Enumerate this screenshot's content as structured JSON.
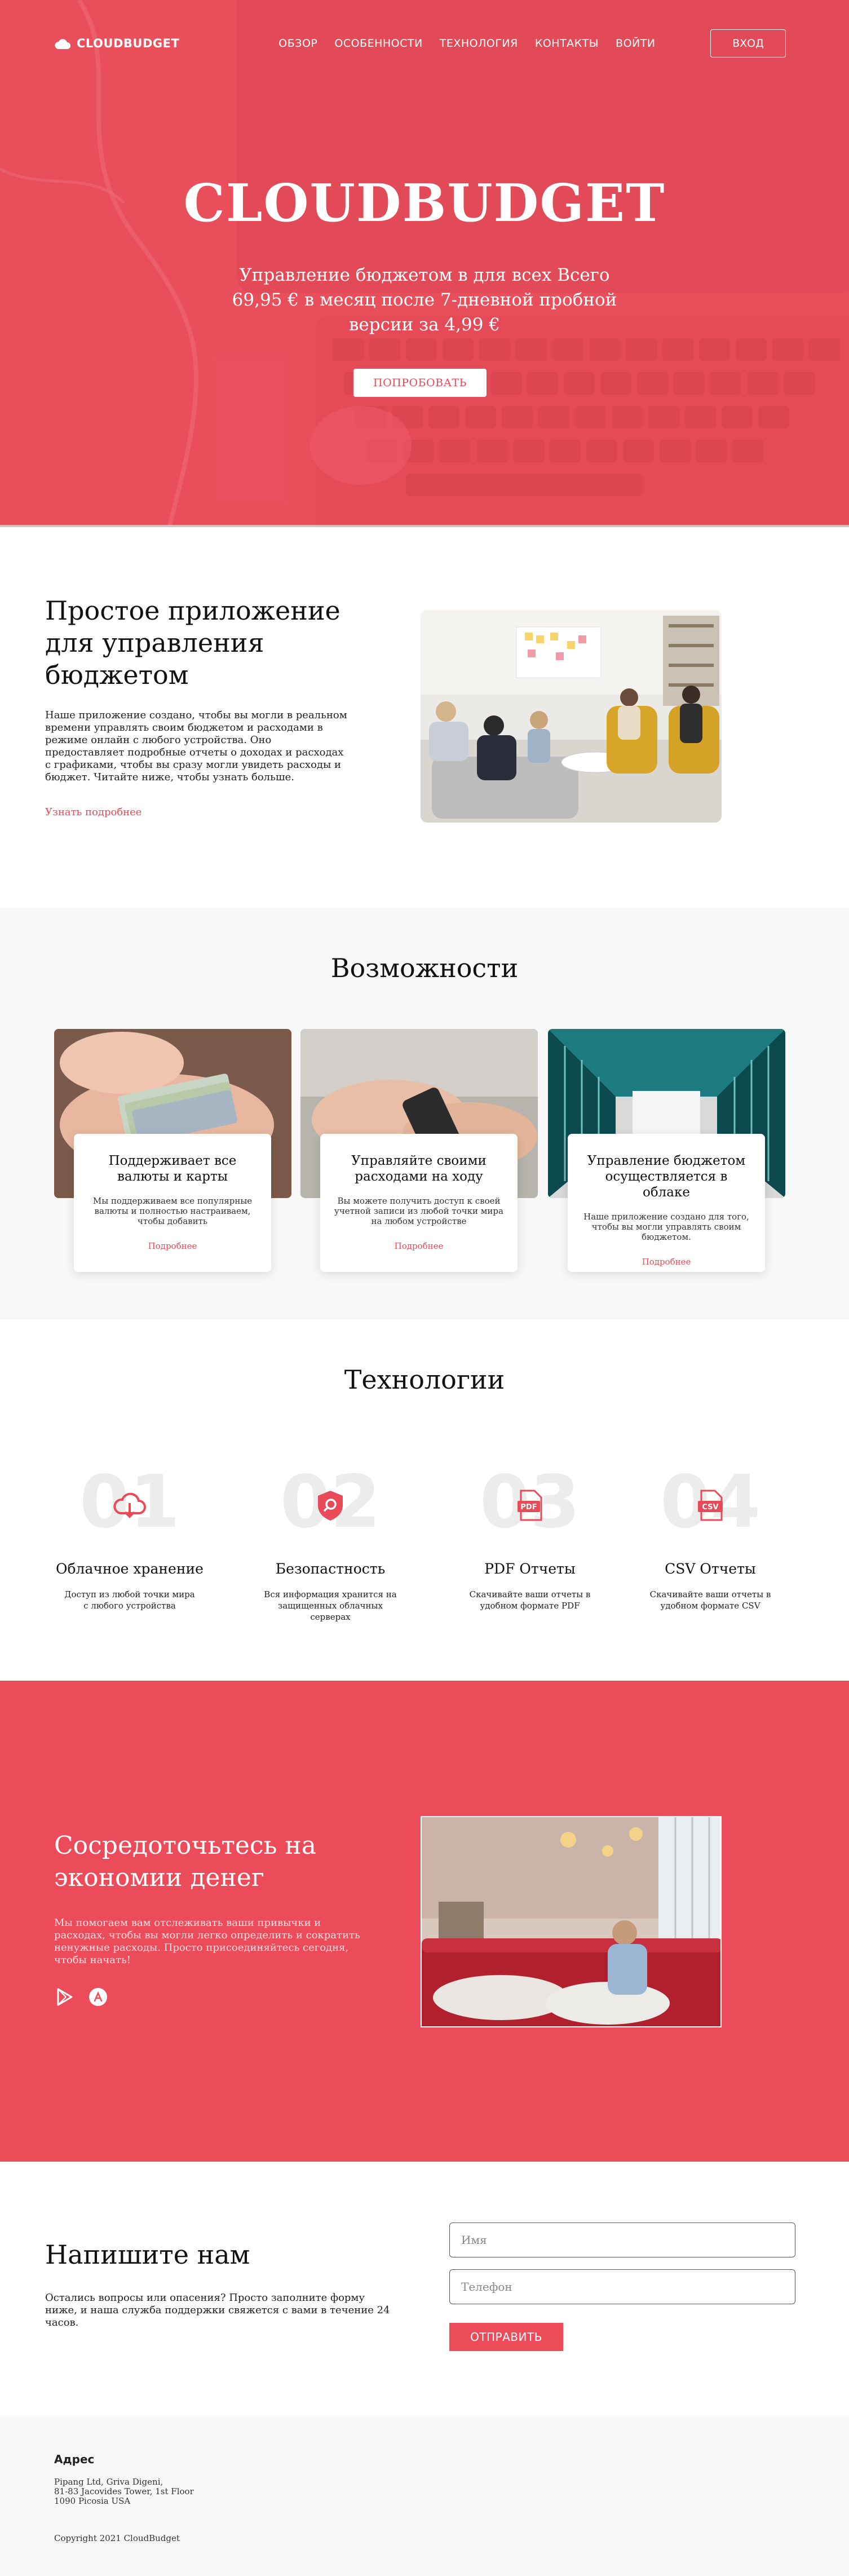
{
  "brand": {
    "name": "CLOUDBUDGET",
    "accent": "#ec4b5a"
  },
  "nav": {
    "links": [
      "ОБЗОР",
      "ОСОБЕННОСТИ",
      "ТЕХНОЛОГИЯ",
      "КОНТАКТЫ",
      "ВОЙТИ"
    ],
    "login_label": "ВХОД"
  },
  "hero": {
    "title": "CLOUDBUDGET",
    "subtitle": "Управление бюджетом в для всех Всего 69,95 € в месяц после 7-дневной пробной версии за 4,99 €",
    "cta_label": "ПОПРОБОВАТЬ"
  },
  "about": {
    "title": "Простое приложение для управления бюджетом",
    "text": "Наше приложение создано, чтобы вы могли в реальном времени управлять своим бюджетом и расходами в режиме онлайн с любого устройства. Оно предоставляет подробные отчеты о доходах и расходах с графиками, чтобы вы сразу могли увидеть расходы и бюджет. Читайте ниже, чтобы узнать больше.",
    "link_label": "Узнать подробнее"
  },
  "features": {
    "title": "Возможности",
    "items": [
      {
        "title": "Поддерживает все валюты и карты",
        "text": "Мы поддерживаем все популярные валюты и полностью настраиваем, чтобы добавить",
        "link": "Подробнее"
      },
      {
        "title": "Управляйте своими расходами на ходу",
        "text": "Вы можете получить доступ к своей учетной записи из любой точки мира на любом устройстве",
        "link": "Подробнее"
      },
      {
        "title": "Управление бюджетом осуществляется в облаке",
        "text": "Наше приложение создано для того, чтобы вы могли управлять своим бюджетом.",
        "link": "Подробнее"
      }
    ]
  },
  "tech": {
    "title": "Технологии",
    "items": [
      {
        "num": "01",
        "icon": "cloud-download-icon",
        "title": "Облачное хранение",
        "text": "Доступ из любой точки мира с любого устройства"
      },
      {
        "num": "02",
        "icon": "shield-search-icon",
        "title": "Безопастность",
        "text": "Вся информация хранится на защищенных облачных серверах"
      },
      {
        "num": "03",
        "icon": "pdf-file-icon",
        "title": "PDF Отчеты",
        "text": "Скачивайте ваши отчеты в удобном формате PDF",
        "badge": "PDF"
      },
      {
        "num": "04",
        "icon": "csv-file-icon",
        "title": "CSV Отчеты",
        "text": "Скачивайте ваши отчеты в удобном формате CSV",
        "badge": "CSV"
      }
    ]
  },
  "focus": {
    "title": "Сосредоточьтесь на экономии денег",
    "text": "Мы помогаем вам отслеживать ваши привычки и расходах, чтобы вы могли легко определить и сократить ненужные расходы. Просто присоединяйтесь сегодня, чтобы начать!"
  },
  "contact": {
    "title": "Напишите нам",
    "text": "Остались вопросы или опасения? Просто заполните форму ниже, и наша служба поддержки свяжется с вами в течение 24 часов.",
    "name_placeholder": "Имя",
    "phone_placeholder": "Телефон",
    "send_label": "ОТПРАВИТЬ"
  },
  "footer": {
    "heading": "Адрес",
    "address_line1": "Pipang Ltd, Griva Digeni,",
    "address_line2": "81-83 Jacovides Tower, 1st Floor",
    "address_line3": "1090 Picosia USA",
    "copyright": "Copyright 2021 CloudBudget"
  }
}
